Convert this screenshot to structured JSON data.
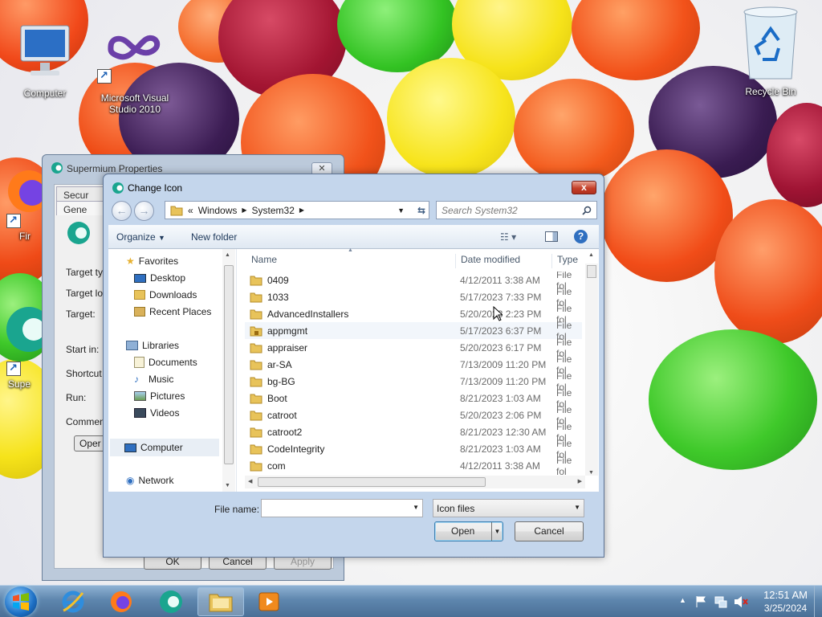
{
  "desktop": {
    "icons": {
      "computer": "Computer",
      "visual_studio": "Microsoft Visual Studio 2010",
      "recycle_bin": "Recycle Bin",
      "firefox_partial": "Fir",
      "supermium_partial": "Supe"
    }
  },
  "bg_window": {
    "title": "Supermium Properties",
    "close_label": "✕",
    "tabs": [
      "Secur",
      "Gene"
    ],
    "fields": [
      "Target ty",
      "Target lo",
      "Target:",
      "Start in:",
      "Shortcut",
      "Run:",
      "Commen"
    ],
    "open_label": "Oper",
    "buttons": {
      "ok": "OK",
      "cancel": "Cancel",
      "apply": "Apply"
    }
  },
  "dialog": {
    "title": "Change Icon",
    "close_label": "x",
    "back_arrow": "←",
    "fwd_arrow": "→",
    "address": {
      "chevron": "«",
      "segments": [
        "Windows",
        "System32"
      ]
    },
    "search_placeholder": "Search System32",
    "toolbar": {
      "organize": "Organize",
      "new_folder": "New folder"
    },
    "nav": {
      "favorites": "Favorites",
      "desktop": "Desktop",
      "downloads": "Downloads",
      "recent": "Recent Places",
      "libraries": "Libraries",
      "documents": "Documents",
      "music": "Music",
      "pictures": "Pictures",
      "videos": "Videos",
      "computer": "Computer",
      "network": "Network"
    },
    "columns": {
      "name": "Name",
      "date": "Date modified",
      "type": "Type"
    },
    "rows": [
      {
        "name": "0409",
        "date": "4/12/2011 3:38 AM",
        "type": "File fol"
      },
      {
        "name": "1033",
        "date": "5/17/2023 7:33 PM",
        "type": "File fol"
      },
      {
        "name": "AdvancedInstallers",
        "date": "5/20/2023 2:23 PM",
        "type": "File fol"
      },
      {
        "name": "appmgmt",
        "date": "5/17/2023 6:37 PM",
        "type": "File fol"
      },
      {
        "name": "appraiser",
        "date": "5/20/2023 6:17 PM",
        "type": "File fol"
      },
      {
        "name": "ar-SA",
        "date": "7/13/2009 11:20 PM",
        "type": "File fol"
      },
      {
        "name": "bg-BG",
        "date": "7/13/2009 11:20 PM",
        "type": "File fol"
      },
      {
        "name": "Boot",
        "date": "8/21/2023 1:03 AM",
        "type": "File fol"
      },
      {
        "name": "catroot",
        "date": "5/20/2023 2:06 PM",
        "type": "File fol"
      },
      {
        "name": "catroot2",
        "date": "8/21/2023 12:30 AM",
        "type": "File fol"
      },
      {
        "name": "CodeIntegrity",
        "date": "8/21/2023 1:03 AM",
        "type": "File fol"
      },
      {
        "name": "com",
        "date": "4/12/2011 3:38 AM",
        "type": "File fol"
      }
    ],
    "file_name_label": "File name:",
    "file_name_value": "",
    "file_type": "Icon files",
    "open_label": "Open",
    "cancel_label": "Cancel"
  },
  "taskbar": {
    "time": "12:51 AM",
    "date": "3/25/2024"
  },
  "colors": {
    "dialog_frame": "#c4d6ec",
    "close_red": "#c5402a",
    "taskbar": "#5e86ae",
    "link_blue": "#1e395b"
  }
}
